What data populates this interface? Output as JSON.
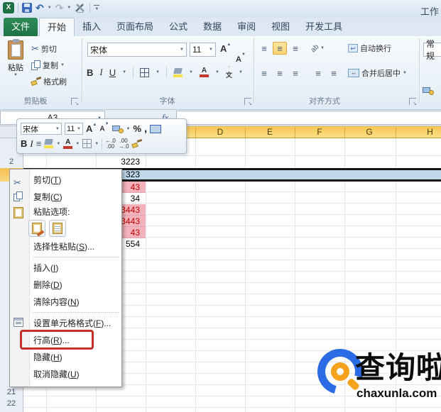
{
  "window": {
    "title": "工作"
  },
  "glyphs": {
    "dd": "▼",
    "undo": "↶",
    "redo": "↷",
    "up": "▲",
    "down": "▼",
    "wrap_arrow": "↩",
    "merge_arrow": "↔",
    "orient": "ab",
    "lines": "≡",
    "dots": "…"
  },
  "tabs": {
    "file": "文件",
    "home": "开始",
    "insert": "插入",
    "layout": "页面布局",
    "formulas": "公式",
    "data": "数据",
    "review": "审阅",
    "view": "视图",
    "developer": "开发工具"
  },
  "ribbon": {
    "clipboard": {
      "group_label": "剪贴板",
      "paste": "粘贴",
      "cut": "剪切",
      "copy": "复制",
      "format_painter": "格式刷"
    },
    "font": {
      "group_label": "字体",
      "name": "宋体",
      "size": "11",
      "bold": "B",
      "italic": "I",
      "underline": "U",
      "grow": "A",
      "shrink": "A",
      "color_letter": "A",
      "phonetic": "文"
    },
    "alignment": {
      "group_label": "对齐方式",
      "wrap": "自动换行",
      "merge": "合并后居中"
    },
    "number": {
      "format": "常规"
    }
  },
  "formula_bar": {
    "name_box": "A3",
    "fx": "fx"
  },
  "mini_toolbar": {
    "font_name": "宋体",
    "font_size": "11",
    "bold": "B",
    "italic": "I",
    "grow": "A",
    "shrink": "A",
    "percent": "%",
    "comma": ",",
    "color_letter": "A",
    "dec_decimal": "←.0\n.00",
    "inc_decimal": ".00\n→.0"
  },
  "grid": {
    "column_headers": [
      "D",
      "E",
      "F",
      "G",
      "H"
    ],
    "row_numbers": {
      "row2": "2",
      "row21": "21",
      "row22": "22"
    },
    "cells": [
      {
        "row": "2",
        "value": "3223",
        "style": "normal"
      },
      {
        "row": "3",
        "value": "323",
        "style": "selected"
      },
      {
        "row": "4",
        "value": "43",
        "style": "pink"
      },
      {
        "row": "5",
        "value": "34",
        "style": "normal"
      },
      {
        "row": "6",
        "value": "3443",
        "style": "pink"
      },
      {
        "row": "7",
        "value": "3443",
        "style": "pink"
      },
      {
        "row": "8",
        "value": "43",
        "style": "pink"
      },
      {
        "row": "9",
        "value": "554",
        "style": "normal"
      }
    ]
  },
  "context_menu": {
    "items": [
      {
        "pre": "剪切(",
        "key": "T",
        "post": ")"
      },
      {
        "pre": "复制(",
        "key": "C",
        "post": ")"
      },
      {
        "pre": "粘贴选项:",
        "key": "",
        "post": ""
      },
      {
        "pre": "选择性粘贴(",
        "key": "S",
        "post": ")..."
      },
      {
        "pre": "插入(",
        "key": "I",
        "post": ")"
      },
      {
        "pre": "删除(",
        "key": "D",
        "post": ")"
      },
      {
        "pre": "清除内容(",
        "key": "N",
        "post": ")"
      },
      {
        "pre": "设置单元格格式(",
        "key": "F",
        "post": ")..."
      },
      {
        "pre": "行高(",
        "key": "R",
        "post": ")..."
      },
      {
        "pre": "隐藏(",
        "key": "H",
        "post": ")"
      },
      {
        "pre": "取消隐藏(",
        "key": "U",
        "post": ")"
      }
    ],
    "annotated_item": "行高(R)..."
  },
  "watermark": {
    "brand": "查询啦",
    "domain": "chaxunla.com"
  },
  "colors": {
    "file_tab_green": "#1F7244",
    "header_selected_gold": "#F8C848",
    "selected_row_blue": "#BFD8EA",
    "bad_cell_bg": "#F4B3BC",
    "bad_cell_text": "#C00000",
    "annotation_red": "#C4302B",
    "brand_blue": "#2B6BE4",
    "brand_orange": "#F6A21C"
  }
}
